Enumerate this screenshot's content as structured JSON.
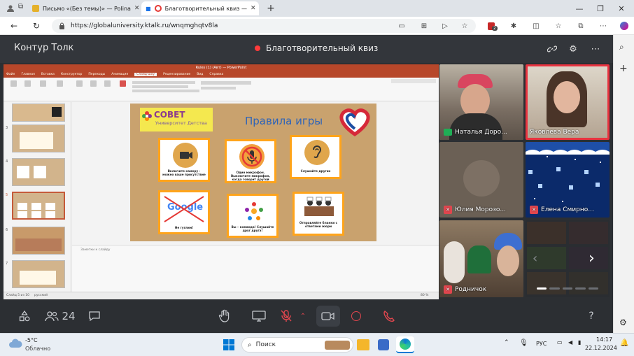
{
  "browser": {
    "tabs": [
      {
        "title": "Письмо «(Без темы)» — Polina",
        "favicon_color": "#e5b12b"
      },
      {
        "title": "Благотворительный квиз —",
        "favicon_color": "#e53935"
      }
    ],
    "new_tab": "+",
    "url": "https://globaluniversity.ktalk.ru/wnqmghqtv8la",
    "badge_count": "2",
    "window_controls": {
      "minimize": "—",
      "maximize": "❐",
      "close": "✕"
    }
  },
  "app": {
    "brand": "Контур Толк",
    "meeting_title": "Благотворительный квиз",
    "participants_count": "24",
    "help": "?"
  },
  "screen_share": {
    "window_title": "Rules (1) (Авт) — PowerPoint",
    "ribbon_tabs": [
      "Файл",
      "Главная",
      "Вставка",
      "Конструктор",
      "Переходы",
      "Анимация",
      "Слайд-шоу",
      "Рецензирование",
      "Вид",
      "Справка"
    ],
    "selected_ribbon_tab": "Слайд-шоу",
    "notes_placeholder": "Заметки к слайду",
    "status_left": "Слайд 5 из 10",
    "status_lang": "русский",
    "zoom": "80 %",
    "slide_numbers": [
      "3",
      "4",
      "5",
      "6",
      "7"
    ],
    "slide": {
      "logo_line1": "СОВЕТ",
      "logo_line2": "Университет Детства",
      "title": "Правила игры",
      "cards": [
        {
          "text": "Включите камеру - можно ваше присутствие"
        },
        {
          "text": "Один микрофон. Выключите микрофон, когда говорит другой"
        },
        {
          "text": "Слушайте других"
        },
        {
          "text": "Google",
          "subtext": "Не гуглим!"
        },
        {
          "text": "Вы – команда! Слушайте друг друга!"
        },
        {
          "text": "Отправляйте бланки с ответами жюри"
        }
      ]
    }
  },
  "participants": [
    {
      "name": "Наталья Доро...",
      "muted": false,
      "sharing": true
    },
    {
      "name": "Яковлева Вера",
      "muted": false,
      "sharing": false
    },
    {
      "name": "Юлия Морозо...",
      "muted": true,
      "sharing": false
    },
    {
      "name": "Елена Смирно...",
      "muted": true,
      "sharing": false
    },
    {
      "name": "Родничок",
      "muted": true,
      "sharing": false
    }
  ],
  "colors": {
    "app_bg": "#2c2f33",
    "record_dot": "#ff3b3b",
    "active_speaker_border": "#e8333f",
    "mic_off": "#e0464e",
    "ppt_accent": "#b7472a"
  },
  "taskbar": {
    "weather_temp": "-5°C",
    "weather_desc": "Облачно",
    "search_placeholder": "Поиск",
    "language": "РУС",
    "time": "14:17",
    "date": "22.12.2024"
  }
}
